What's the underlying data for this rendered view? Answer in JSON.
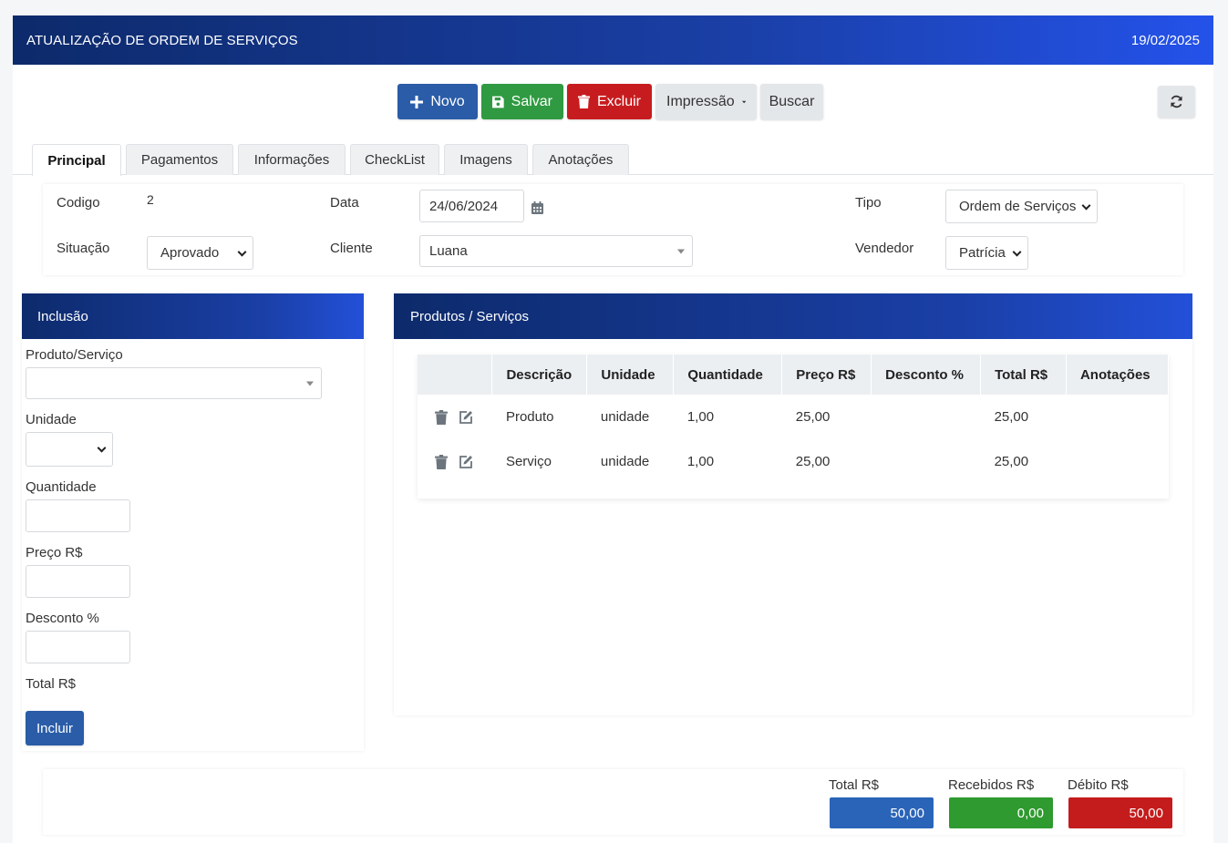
{
  "header": {
    "title": "ATUALIZAÇÃO DE ORDEM DE SERVIÇOS",
    "date": "19/02/2025"
  },
  "toolbar": {
    "novo": "Novo",
    "salvar": "Salvar",
    "excluir": "Excluir",
    "impressao": "Impressão",
    "buscar": "Buscar"
  },
  "tabs": [
    "Principal",
    "Pagamentos",
    "Informações",
    "CheckList",
    "Imagens",
    "Anotações"
  ],
  "form": {
    "codigo_label": "Codigo",
    "codigo_value": "2",
    "data_label": "Data",
    "data_value": "24/06/2024",
    "tipo_label": "Tipo",
    "tipo_value": "Ordem de Serviços",
    "situacao_label": "Situação",
    "situacao_value": "Aprovado",
    "cliente_label": "Cliente",
    "cliente_value": "Luana",
    "vendedor_label": "Vendedor",
    "vendedor_value": "Patrícia"
  },
  "inclusao": {
    "title": "Inclusão",
    "produto_label": "Produto/Serviço",
    "unidade_label": "Unidade",
    "quantidade_label": "Quantidade",
    "preco_label": "Preço R$",
    "desconto_label": "Desconto %",
    "total_label": "Total R$",
    "incluir": "Incluir"
  },
  "produtos": {
    "title": "Produtos / Serviços",
    "columns": [
      "",
      "Descrição",
      "Unidade",
      "Quantidade",
      "Preço R$",
      "Desconto %",
      "Total R$",
      "Anotações"
    ],
    "rows": [
      {
        "descricao": "Produto",
        "unidade": "unidade",
        "quantidade": "1,00",
        "preco": "25,00",
        "desconto": "",
        "total": "25,00",
        "anotacoes": ""
      },
      {
        "descricao": "Serviço",
        "unidade": "unidade",
        "quantidade": "1,00",
        "preco": "25,00",
        "desconto": "",
        "total": "25,00",
        "anotacoes": ""
      }
    ]
  },
  "totals": {
    "total_label": "Total R$",
    "total_value": "50,00",
    "recebidos_label": "Recebidos R$",
    "recebidos_value": "0,00",
    "debito_label": "Débito R$",
    "debito_value": "50,00",
    "colors": {
      "total": "#2a64b8",
      "recebidos": "#2f9a2f",
      "debito": "#c41c1c"
    }
  },
  "icons": [
    "plus-icon",
    "save-icon",
    "trash-icon",
    "caret-down-icon",
    "refresh-icon",
    "calendar-icon",
    "edit-icon"
  ]
}
